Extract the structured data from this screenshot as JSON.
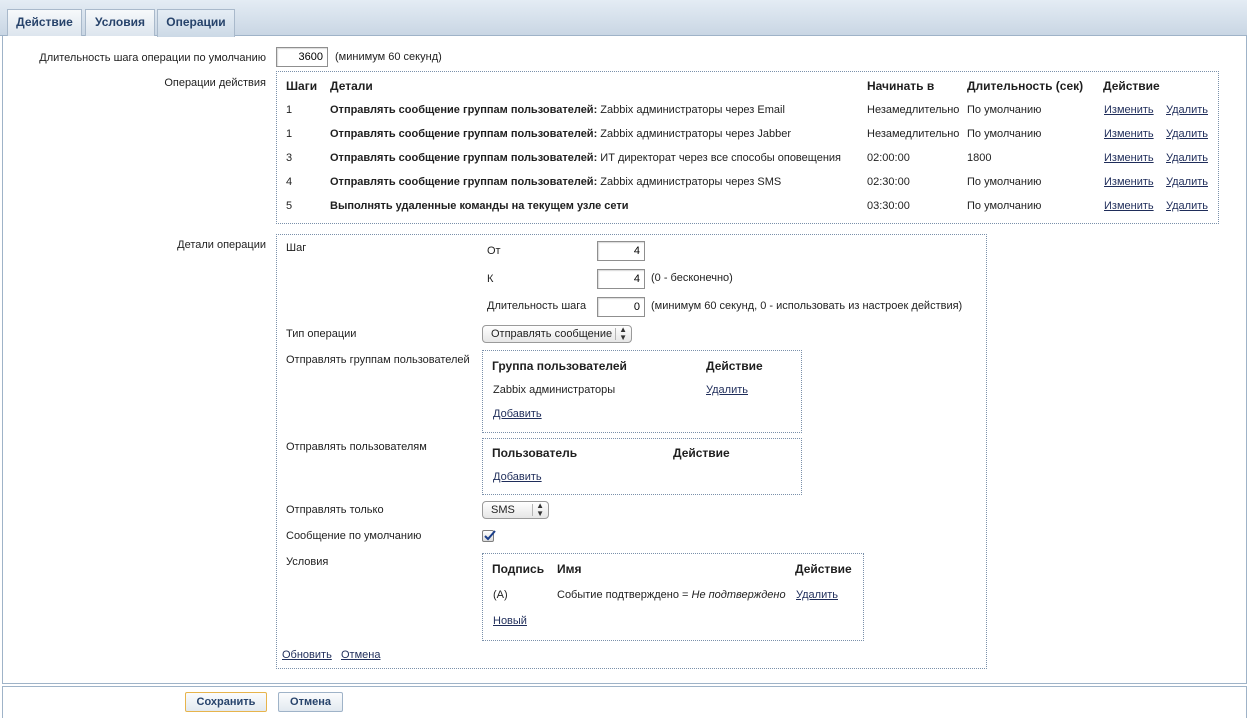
{
  "tabs": [
    {
      "label": "Действие"
    },
    {
      "label": "Условия"
    },
    {
      "label": "Операции"
    }
  ],
  "default_step": {
    "label": "Длительность шага операции по умолчанию",
    "value": "3600",
    "hint": "(минимум 60 секунд)"
  },
  "operations": {
    "label": "Операции действия",
    "headers": {
      "steps": "Шаги",
      "details": "Детали",
      "start_in": "Начинать в",
      "duration": "Длительность (сек)",
      "action": "Действие"
    },
    "rows": [
      {
        "step": "1",
        "bold": "Отправлять сообщение группам пользователей:",
        "rest": " Zabbix администраторы через Email",
        "start": "Незамедлительно",
        "duration": "По умолчанию",
        "edit": "Изменить",
        "delete": "Удалить"
      },
      {
        "step": "1",
        "bold": "Отправлять сообщение группам пользователей:",
        "rest": " Zabbix администраторы через Jabber",
        "start": "Незамедлительно",
        "duration": "По умолчанию",
        "edit": "Изменить",
        "delete": "Удалить"
      },
      {
        "step": "3",
        "bold": "Отправлять сообщение группам пользователей:",
        "rest": " ИТ директорат через все способы оповещения",
        "start": "02:00:00",
        "duration": "1800",
        "edit": "Изменить",
        "delete": "Удалить"
      },
      {
        "step": "4",
        "bold": "Отправлять сообщение группам пользователей:",
        "rest": " Zabbix администраторы через SMS",
        "start": "02:30:00",
        "duration": "По умолчанию",
        "edit": "Изменить",
        "delete": "Удалить"
      },
      {
        "step": "5",
        "bold": "Выполнять удаленные команды на текущем узле сети",
        "rest": "",
        "start": "03:30:00",
        "duration": "По умолчанию",
        "edit": "Изменить",
        "delete": "Удалить"
      }
    ]
  },
  "details": {
    "label": "Детали операции",
    "step_label": "Шаг",
    "from_label": "От",
    "from_value": "4",
    "to_label": "К",
    "to_value": "4",
    "to_hint": "(0 - бесконечно)",
    "duration_label": "Длительность шага",
    "duration_value": "0",
    "duration_hint": "(минимум 60 секунд, 0 - использовать из настроек действия)",
    "op_type_label": "Тип операции",
    "op_type_value": "Отправлять сообщение",
    "groups": {
      "label": "Отправлять группам пользователей",
      "col_group": "Группа пользователей",
      "col_action": "Действие",
      "row_name": "Zabbix администраторы",
      "row_delete": "Удалить",
      "add": "Добавить"
    },
    "users": {
      "label": "Отправлять пользователям",
      "col_user": "Пользователь",
      "col_action": "Действие",
      "add": "Добавить"
    },
    "send_only_label": "Отправлять только",
    "send_only_value": "SMS",
    "default_msg_label": "Сообщение по умолчанию",
    "default_msg_checked": true,
    "conditions": {
      "label": "Условия",
      "col_label": "Подпись",
      "col_name": "Имя",
      "col_action": "Действие",
      "row_label": "(A)",
      "row_name_plain": "Событие подтверждено = ",
      "row_name_italic": "Не подтверждено",
      "row_delete": "Удалить",
      "new": "Новый"
    },
    "update": "Обновить",
    "cancel": "Отмена"
  },
  "footer": {
    "save": "Сохранить",
    "cancel": "Отмена"
  }
}
